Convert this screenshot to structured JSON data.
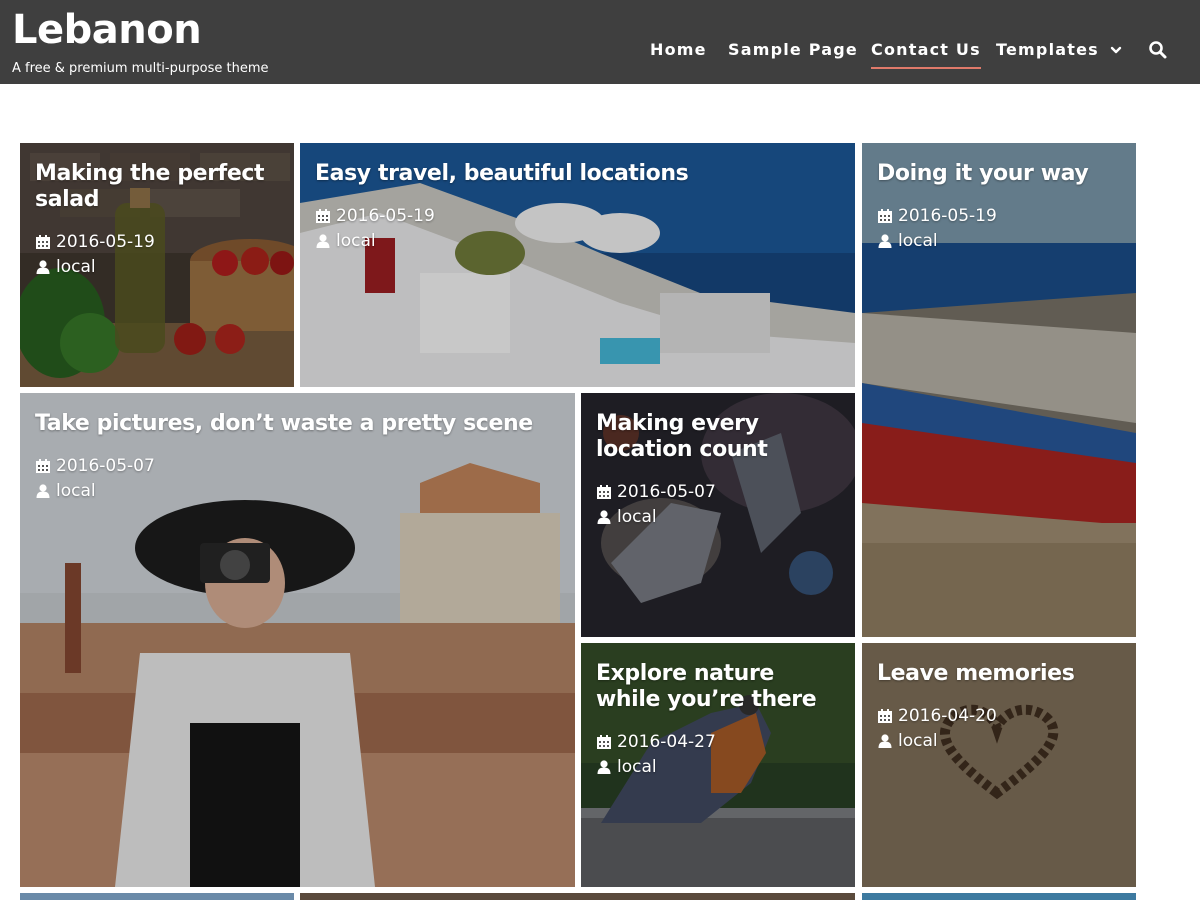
{
  "site": {
    "title": "Lebanon",
    "tagline": "A free & premium multi-purpose theme"
  },
  "nav": {
    "items": [
      {
        "label": "Home"
      },
      {
        "label": "Sample Page"
      },
      {
        "label": "Contact Us",
        "active": true
      },
      {
        "label": "Templates",
        "has_dropdown": true
      }
    ],
    "search_icon": "search-icon"
  },
  "colors": {
    "header_bg": "#3f3f3f",
    "active_underline": "#e07a6a",
    "text_on_image": "#ffffff"
  },
  "posts": [
    {
      "title": "Making the perfect salad",
      "date": "2016-05-19",
      "author": "local",
      "image": "salad-vegetables"
    },
    {
      "title": "Easy travel, beautiful locations",
      "date": "2016-05-19",
      "author": "local",
      "image": "santorini-coast"
    },
    {
      "title": "Doing it your way",
      "date": "2016-05-19",
      "author": "local",
      "image": "red-boat-beach"
    },
    {
      "title": "Take pictures, don’t waste a pretty scene",
      "date": "2016-05-07",
      "author": "local",
      "image": "woman-with-camera"
    },
    {
      "title": "Making every location count",
      "date": "2016-05-07",
      "author": "local",
      "image": "metal-sculpture"
    },
    {
      "title": "Explore nature while you’re there",
      "date": "2016-04-27",
      "author": "local",
      "image": "robin-bird"
    },
    {
      "title": "Leave memories",
      "date": "2016-04-20",
      "author": "local",
      "image": "pebble-heart-sand"
    }
  ],
  "icons": {
    "date": "calendar-icon",
    "author": "user-icon",
    "dropdown": "chevron-down-icon"
  }
}
